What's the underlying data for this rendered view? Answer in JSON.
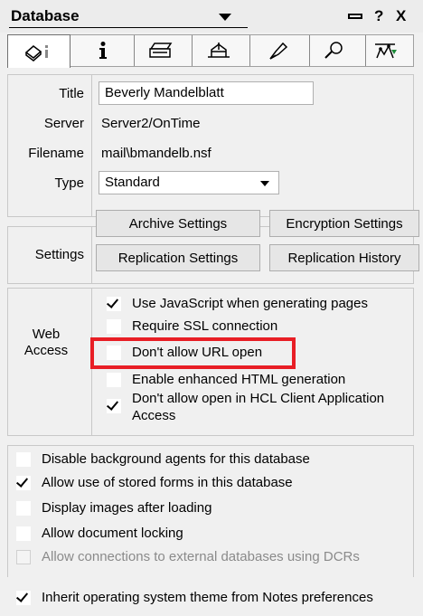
{
  "titlebar": {
    "title": "Database",
    "help": "?",
    "close": "X"
  },
  "tabs": [
    {
      "icon": "info-basics-icon",
      "active": true
    },
    {
      "icon": "info-icon",
      "active": false
    },
    {
      "icon": "printer-icon",
      "active": false
    },
    {
      "icon": "design-icon",
      "active": false
    },
    {
      "icon": "advanced-icon",
      "active": false
    },
    {
      "icon": "search-icon",
      "active": false
    },
    {
      "icon": "chart-icon",
      "active": false
    }
  ],
  "info": {
    "title_label": "Title",
    "title_value": "Beverly Mandelblatt",
    "server_label": "Server",
    "server_value": "Server2/OnTime",
    "filename_label": "Filename",
    "filename_value": "mail\\bmandelb.nsf",
    "type_label": "Type",
    "type_value": "Standard"
  },
  "settings": {
    "label": "Settings",
    "archive": "Archive Settings",
    "encryption": "Encryption Settings",
    "replication": "Replication Settings",
    "replication_history": "Replication History"
  },
  "web_access": {
    "label_line1": "Web",
    "label_line2": "Access",
    "options": [
      {
        "label": "Use JavaScript when generating pages",
        "checked": true
      },
      {
        "label": "Require SSL connection",
        "checked": false
      },
      {
        "label": "Don't allow URL open",
        "checked": false
      },
      {
        "label": "Enable enhanced HTML generation",
        "checked": false
      },
      {
        "label": "Don't allow open in HCL Client Application Access",
        "checked": true
      }
    ]
  },
  "misc": {
    "options": [
      {
        "label": "Disable background agents for this database",
        "checked": false,
        "disabled": false
      },
      {
        "label": "Allow use of stored forms in this database",
        "checked": true,
        "disabled": false
      },
      {
        "label": "Display images after loading",
        "checked": false,
        "disabled": false
      },
      {
        "label": "Allow document locking",
        "checked": false,
        "disabled": false
      },
      {
        "label": "Allow connections to external databases using DCRs",
        "checked": false,
        "disabled": true
      }
    ],
    "inherit": {
      "label": "Inherit operating system theme from Notes preferences",
      "checked": true
    }
  },
  "colors": {
    "highlight": "#e81e25"
  }
}
